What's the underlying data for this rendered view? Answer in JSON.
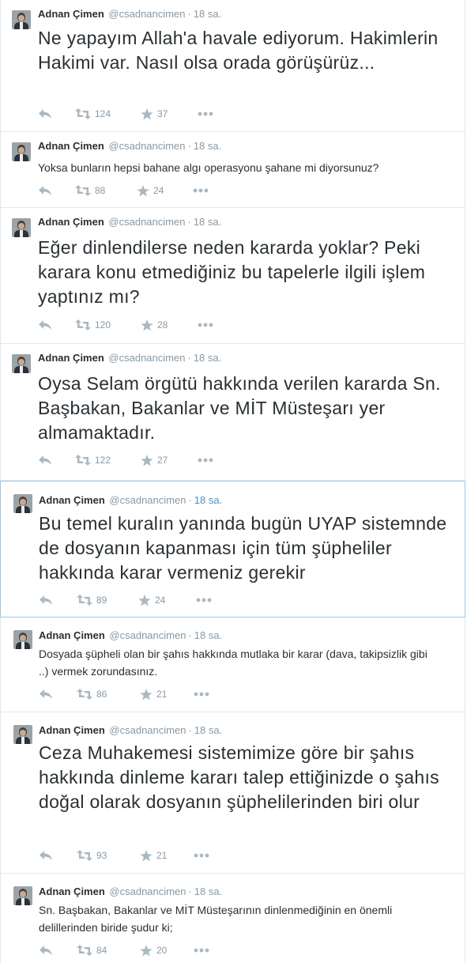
{
  "tweets": [
    {
      "name": "Adnan Çimen",
      "handle": "@csadnancimen",
      "sep": "·",
      "time": "18 sa.",
      "text": "Ne yapayım Allah'a havale ediyorum. Hakimlerin Hakimi var. Nasıl olsa orada görüşürüz...",
      "retweets": "124",
      "favorites": "37"
    },
    {
      "name": "Adnan Çimen",
      "handle": "@csadnancimen",
      "sep": "·",
      "time": "18 sa.",
      "text": "Yoksa bunların hepsi bahane algı operasyonu şahane mi diyorsunuz?",
      "retweets": "88",
      "favorites": "24"
    },
    {
      "name": "Adnan Çimen",
      "handle": "@csadnancimen",
      "sep": "·",
      "time": "18 sa.",
      "text": "Eğer dinlendilerse neden kararda yoklar? Peki karara konu etmediğiniz bu tapelerle ilgili işlem yaptınız mı?",
      "retweets": "120",
      "favorites": "28"
    },
    {
      "name": "Adnan Çimen",
      "handle": "@csadnancimen",
      "sep": "·",
      "time": "18 sa.",
      "text": "Oysa Selam örgütü hakkında verilen kararda Sn. Başbakan, Bakanlar ve MİT Müsteşarı yer almamaktadır.",
      "retweets": "122",
      "favorites": "27"
    },
    {
      "name": "Adnan Çimen",
      "handle": "@csadnancimen",
      "sep": "·",
      "time": "18 sa.",
      "text": "Bu temel kuralın yanında bugün UYAP sistemnde de dosyanın kapanması için tüm şüpheliler hakkında karar vermeniz gerekir",
      "retweets": "89",
      "favorites": "24"
    },
    {
      "name": "Adnan Çimen",
      "handle": "@csadnancimen",
      "sep": "·",
      "time": "18 sa.",
      "text": "Dosyada şüpheli olan bir şahıs hakkında mutlaka bir karar (dava, takipsizlik gibi ..) vermek zorundasınız.",
      "retweets": "86",
      "favorites": "21"
    },
    {
      "name": "Adnan Çimen",
      "handle": "@csadnancimen",
      "sep": "·",
      "time": "18 sa.",
      "text": "Ceza Muhakemesi sistemimize göre bir şahıs hakkında dinleme kararı talep ettiğinizde o şahıs doğal olarak dosyanın şüphelilerinden biri olur",
      "retweets": "93",
      "favorites": "21"
    },
    {
      "name": "Adnan Çimen",
      "handle": "@csadnancimen",
      "sep": "·",
      "time": "18 sa.",
      "text": "Sn. Başbakan, Bakanlar ve MİT Müsteşarının dinlenmediğinin en önemli delillerinden biride şudur ki;",
      "retweets": "84",
      "favorites": "20"
    }
  ],
  "icons": {
    "reply": "reply-icon",
    "retweet": "retweet-icon",
    "favorite": "star-icon",
    "more": "more-icon"
  },
  "colors": {
    "name": "#292f33",
    "meta": "#8899a6",
    "icon": "#aab8c2",
    "highlight_border": "#9fc7e3",
    "highlight_time": "#4a90c2",
    "divider": "#e1e8ed"
  }
}
